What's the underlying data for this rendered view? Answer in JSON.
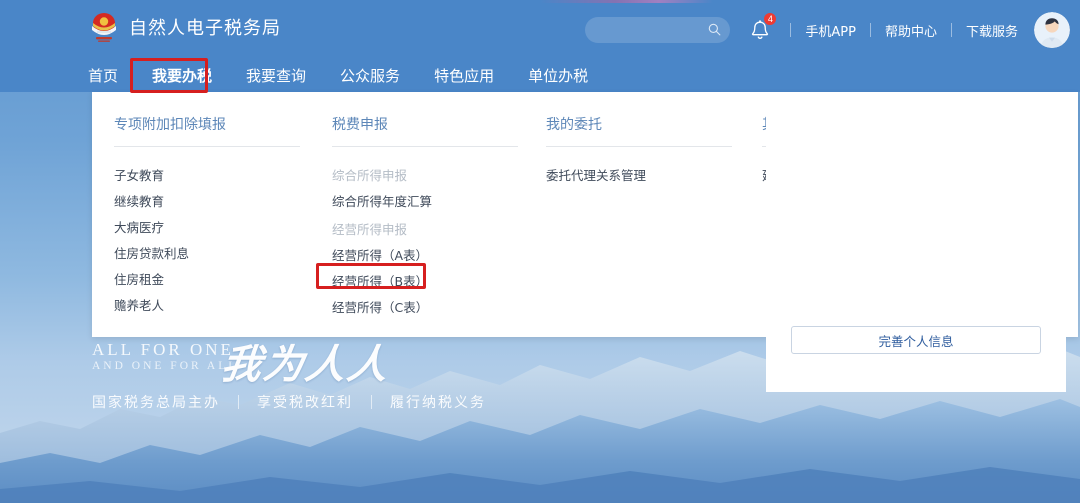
{
  "brand": {
    "title": "自然人电子税务局",
    "emblem_icon": "tax-emblem-icon"
  },
  "header": {
    "search": {
      "value": "",
      "placeholder": "",
      "icon": "search-icon"
    },
    "notifications": {
      "icon": "bell-icon",
      "badge": "4"
    },
    "links": [
      {
        "label": "手机APP"
      },
      {
        "label": "帮助中心"
      },
      {
        "label": "下载服务"
      }
    ],
    "avatar": {
      "icon": "user-avatar-icon"
    }
  },
  "nav": {
    "items": [
      {
        "label": "首页",
        "active": false
      },
      {
        "label": "我要办税",
        "active": true
      },
      {
        "label": "我要查询",
        "active": false
      },
      {
        "label": "公众服务",
        "active": false
      },
      {
        "label": "特色应用",
        "active": false
      },
      {
        "label": "单位办税",
        "active": false
      }
    ]
  },
  "dropdown": {
    "columns": [
      {
        "title": "专项附加扣除填报",
        "items": [
          {
            "label": "子女教育",
            "type": "item"
          },
          {
            "label": "继续教育",
            "type": "item"
          },
          {
            "label": "大病医疗",
            "type": "item"
          },
          {
            "label": "住房贷款利息",
            "type": "item"
          },
          {
            "label": "住房租金",
            "type": "item"
          },
          {
            "label": "赡养老人",
            "type": "item"
          }
        ]
      },
      {
        "title": "税费申报",
        "items": [
          {
            "label": "综合所得申报",
            "type": "group"
          },
          {
            "label": "综合所得年度汇算",
            "type": "item"
          },
          {
            "label": "经营所得申报",
            "type": "group"
          },
          {
            "label": "经营所得（A表）",
            "type": "item"
          },
          {
            "label": "经营所得（B表）",
            "type": "item"
          },
          {
            "label": "经营所得（C表）",
            "type": "item"
          }
        ]
      },
      {
        "title": "我的委托",
        "items": [
          {
            "label": "委托代理关系管理",
            "type": "item"
          }
        ]
      },
      {
        "title": "其他",
        "items": [
          {
            "label": "延期申报申请",
            "type": "item"
          }
        ]
      }
    ]
  },
  "slogan": {
    "en_line1": "ALL  FOR  ONE",
    "en_line2": "AND  ONE  FOR  ALL",
    "cn": "我为人人",
    "footer": [
      {
        "label": "国家税务总局主办"
      },
      {
        "label": "享受税改红利"
      },
      {
        "label": "履行纳税义务"
      }
    ]
  },
  "right_card": {
    "button_label": "完善个人信息"
  },
  "highlights": [
    {
      "name": "nav-highlight",
      "target": "我要办税",
      "color": "#d61f1f"
    },
    {
      "name": "menu-highlight",
      "target": "经营所得（B表）",
      "color": "#d61f1f"
    }
  ],
  "colors": {
    "header_blue": "#4a86c8",
    "accent_red": "#d61f1f",
    "column_title": "#5d87b8",
    "badge_red": "#ee3b33"
  }
}
